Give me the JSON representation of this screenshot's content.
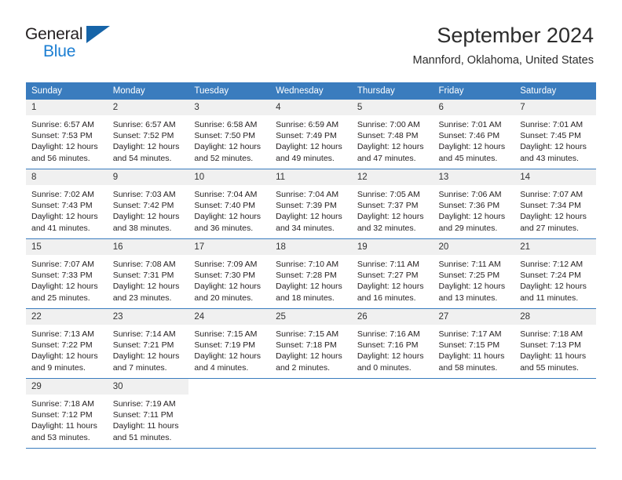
{
  "brand": {
    "name_top": "General",
    "name_bottom": "Blue",
    "logo_icon": "triangle-flag-icon"
  },
  "header": {
    "title": "September 2024",
    "location": "Mannford, Oklahoma, United States"
  },
  "calendar": {
    "weekday_headers": [
      "Sunday",
      "Monday",
      "Tuesday",
      "Wednesday",
      "Thursday",
      "Friday",
      "Saturday"
    ],
    "accent_color": "#3a7cbe",
    "daynum_background": "#f0f0f0",
    "weeks": [
      [
        {
          "day": "1",
          "sunrise": "Sunrise: 6:57 AM",
          "sunset": "Sunset: 7:53 PM",
          "daylight_line1": "Daylight: 12 hours",
          "daylight_line2": "and 56 minutes."
        },
        {
          "day": "2",
          "sunrise": "Sunrise: 6:57 AM",
          "sunset": "Sunset: 7:52 PM",
          "daylight_line1": "Daylight: 12 hours",
          "daylight_line2": "and 54 minutes."
        },
        {
          "day": "3",
          "sunrise": "Sunrise: 6:58 AM",
          "sunset": "Sunset: 7:50 PM",
          "daylight_line1": "Daylight: 12 hours",
          "daylight_line2": "and 52 minutes."
        },
        {
          "day": "4",
          "sunrise": "Sunrise: 6:59 AM",
          "sunset": "Sunset: 7:49 PM",
          "daylight_line1": "Daylight: 12 hours",
          "daylight_line2": "and 49 minutes."
        },
        {
          "day": "5",
          "sunrise": "Sunrise: 7:00 AM",
          "sunset": "Sunset: 7:48 PM",
          "daylight_line1": "Daylight: 12 hours",
          "daylight_line2": "and 47 minutes."
        },
        {
          "day": "6",
          "sunrise": "Sunrise: 7:01 AM",
          "sunset": "Sunset: 7:46 PM",
          "daylight_line1": "Daylight: 12 hours",
          "daylight_line2": "and 45 minutes."
        },
        {
          "day": "7",
          "sunrise": "Sunrise: 7:01 AM",
          "sunset": "Sunset: 7:45 PM",
          "daylight_line1": "Daylight: 12 hours",
          "daylight_line2": "and 43 minutes."
        }
      ],
      [
        {
          "day": "8",
          "sunrise": "Sunrise: 7:02 AM",
          "sunset": "Sunset: 7:43 PM",
          "daylight_line1": "Daylight: 12 hours",
          "daylight_line2": "and 41 minutes."
        },
        {
          "day": "9",
          "sunrise": "Sunrise: 7:03 AM",
          "sunset": "Sunset: 7:42 PM",
          "daylight_line1": "Daylight: 12 hours",
          "daylight_line2": "and 38 minutes."
        },
        {
          "day": "10",
          "sunrise": "Sunrise: 7:04 AM",
          "sunset": "Sunset: 7:40 PM",
          "daylight_line1": "Daylight: 12 hours",
          "daylight_line2": "and 36 minutes."
        },
        {
          "day": "11",
          "sunrise": "Sunrise: 7:04 AM",
          "sunset": "Sunset: 7:39 PM",
          "daylight_line1": "Daylight: 12 hours",
          "daylight_line2": "and 34 minutes."
        },
        {
          "day": "12",
          "sunrise": "Sunrise: 7:05 AM",
          "sunset": "Sunset: 7:37 PM",
          "daylight_line1": "Daylight: 12 hours",
          "daylight_line2": "and 32 minutes."
        },
        {
          "day": "13",
          "sunrise": "Sunrise: 7:06 AM",
          "sunset": "Sunset: 7:36 PM",
          "daylight_line1": "Daylight: 12 hours",
          "daylight_line2": "and 29 minutes."
        },
        {
          "day": "14",
          "sunrise": "Sunrise: 7:07 AM",
          "sunset": "Sunset: 7:34 PM",
          "daylight_line1": "Daylight: 12 hours",
          "daylight_line2": "and 27 minutes."
        }
      ],
      [
        {
          "day": "15",
          "sunrise": "Sunrise: 7:07 AM",
          "sunset": "Sunset: 7:33 PM",
          "daylight_line1": "Daylight: 12 hours",
          "daylight_line2": "and 25 minutes."
        },
        {
          "day": "16",
          "sunrise": "Sunrise: 7:08 AM",
          "sunset": "Sunset: 7:31 PM",
          "daylight_line1": "Daylight: 12 hours",
          "daylight_line2": "and 23 minutes."
        },
        {
          "day": "17",
          "sunrise": "Sunrise: 7:09 AM",
          "sunset": "Sunset: 7:30 PM",
          "daylight_line1": "Daylight: 12 hours",
          "daylight_line2": "and 20 minutes."
        },
        {
          "day": "18",
          "sunrise": "Sunrise: 7:10 AM",
          "sunset": "Sunset: 7:28 PM",
          "daylight_line1": "Daylight: 12 hours",
          "daylight_line2": "and 18 minutes."
        },
        {
          "day": "19",
          "sunrise": "Sunrise: 7:11 AM",
          "sunset": "Sunset: 7:27 PM",
          "daylight_line1": "Daylight: 12 hours",
          "daylight_line2": "and 16 minutes."
        },
        {
          "day": "20",
          "sunrise": "Sunrise: 7:11 AM",
          "sunset": "Sunset: 7:25 PM",
          "daylight_line1": "Daylight: 12 hours",
          "daylight_line2": "and 13 minutes."
        },
        {
          "day": "21",
          "sunrise": "Sunrise: 7:12 AM",
          "sunset": "Sunset: 7:24 PM",
          "daylight_line1": "Daylight: 12 hours",
          "daylight_line2": "and 11 minutes."
        }
      ],
      [
        {
          "day": "22",
          "sunrise": "Sunrise: 7:13 AM",
          "sunset": "Sunset: 7:22 PM",
          "daylight_line1": "Daylight: 12 hours",
          "daylight_line2": "and 9 minutes."
        },
        {
          "day": "23",
          "sunrise": "Sunrise: 7:14 AM",
          "sunset": "Sunset: 7:21 PM",
          "daylight_line1": "Daylight: 12 hours",
          "daylight_line2": "and 7 minutes."
        },
        {
          "day": "24",
          "sunrise": "Sunrise: 7:15 AM",
          "sunset": "Sunset: 7:19 PM",
          "daylight_line1": "Daylight: 12 hours",
          "daylight_line2": "and 4 minutes."
        },
        {
          "day": "25",
          "sunrise": "Sunrise: 7:15 AM",
          "sunset": "Sunset: 7:18 PM",
          "daylight_line1": "Daylight: 12 hours",
          "daylight_line2": "and 2 minutes."
        },
        {
          "day": "26",
          "sunrise": "Sunrise: 7:16 AM",
          "sunset": "Sunset: 7:16 PM",
          "daylight_line1": "Daylight: 12 hours",
          "daylight_line2": "and 0 minutes."
        },
        {
          "day": "27",
          "sunrise": "Sunrise: 7:17 AM",
          "sunset": "Sunset: 7:15 PM",
          "daylight_line1": "Daylight: 11 hours",
          "daylight_line2": "and 58 minutes."
        },
        {
          "day": "28",
          "sunrise": "Sunrise: 7:18 AM",
          "sunset": "Sunset: 7:13 PM",
          "daylight_line1": "Daylight: 11 hours",
          "daylight_line2": "and 55 minutes."
        }
      ],
      [
        {
          "day": "29",
          "sunrise": "Sunrise: 7:18 AM",
          "sunset": "Sunset: 7:12 PM",
          "daylight_line1": "Daylight: 11 hours",
          "daylight_line2": "and 53 minutes."
        },
        {
          "day": "30",
          "sunrise": "Sunrise: 7:19 AM",
          "sunset": "Sunset: 7:11 PM",
          "daylight_line1": "Daylight: 11 hours",
          "daylight_line2": "and 51 minutes."
        },
        {
          "day": "",
          "sunrise": "",
          "sunset": "",
          "daylight_line1": "",
          "daylight_line2": ""
        },
        {
          "day": "",
          "sunrise": "",
          "sunset": "",
          "daylight_line1": "",
          "daylight_line2": ""
        },
        {
          "day": "",
          "sunrise": "",
          "sunset": "",
          "daylight_line1": "",
          "daylight_line2": ""
        },
        {
          "day": "",
          "sunrise": "",
          "sunset": "",
          "daylight_line1": "",
          "daylight_line2": ""
        },
        {
          "day": "",
          "sunrise": "",
          "sunset": "",
          "daylight_line1": "",
          "daylight_line2": ""
        }
      ]
    ]
  }
}
